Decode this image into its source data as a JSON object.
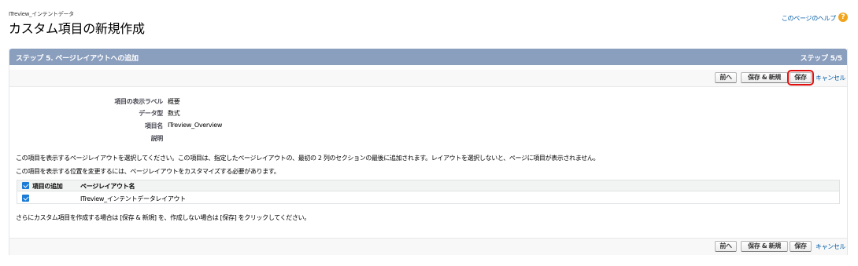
{
  "header": {
    "object_name": "ITreview_インテントデータ",
    "page_title": "カスタム項目の新規作成",
    "help_link": "このページのヘルプ",
    "help_icon_glyph": "?"
  },
  "step": {
    "title": "ステップ 5. ページレイアウトへの追加",
    "count": "ステップ 5/5"
  },
  "buttons": {
    "prev": "前へ",
    "save_new": "保存 & 新規",
    "save": "保存",
    "cancel": "キャンセル"
  },
  "details": [
    {
      "label": "項目の表示ラベル",
      "value": "概要"
    },
    {
      "label": "データ型",
      "value": "数式"
    },
    {
      "label": "項目名",
      "value": "ITreview_Overview"
    },
    {
      "label": "説明",
      "value": ""
    }
  ],
  "info": {
    "line1": "この項目を表示するページレイアウトを選択してください。この項目は、指定したページレイアウトの、最初の 2 列のセクションの最後に追加されます。レイアウトを選択しないと、ページに項目が表示されません。",
    "line2": "この項目を表示する位置を変更するには、ページレイアウトをカスタマイズする必要があります。",
    "footer": "さらにカスタム項目を作成する場合は [保存 & 新規] を、作成しない場合は [保存] をクリックしてください。"
  },
  "layout_table": {
    "headers": [
      "項目の追加",
      "ページレイアウト名"
    ],
    "rows": [
      {
        "checked": true,
        "name": "ITreview_インテントデータレイアウト"
      }
    ]
  },
  "colors": {
    "step_header": "#8a9ebe",
    "link": "#015ba7",
    "highlight": "#e01010",
    "checkbox": "#1b7bd6"
  }
}
